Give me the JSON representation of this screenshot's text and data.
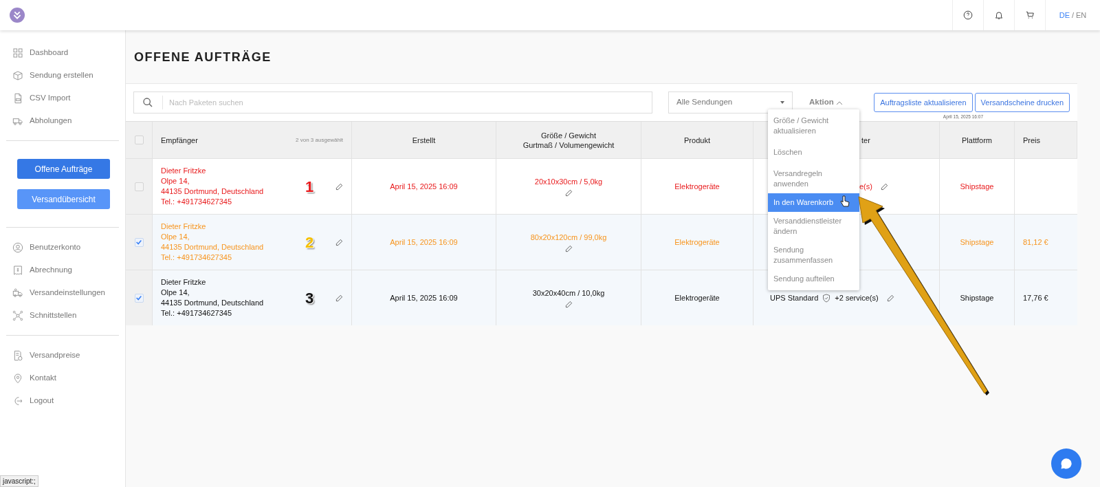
{
  "topbar": {
    "languages": [
      {
        "label": "DE",
        "selected": true
      },
      {
        "label": "EN",
        "selected": false
      }
    ],
    "language_separator": "/"
  },
  "sidebar": {
    "groups": [
      {
        "kind": "nav",
        "items": [
          "Dashboard",
          "Sendung erstellen",
          "CSV Import",
          "Abholungen"
        ]
      },
      {
        "kind": "buttons",
        "items": [
          {
            "label": "Offene Aufträge",
            "selected": true
          },
          {
            "label": "Versandübersicht",
            "selected": false
          }
        ]
      },
      {
        "kind": "nav",
        "items": [
          "Benutzerkonto",
          "Abrechnung",
          "Versandeinstellungen",
          "Schnittstellen"
        ]
      },
      {
        "kind": "nav",
        "items": [
          "Versandpreise",
          "Kontakt",
          "Logout"
        ]
      }
    ]
  },
  "page_title": "OFFENE AUFTRÄGE",
  "toolbar": {
    "search": {
      "placeholder": "Nach Paketen suchen"
    },
    "filter": {
      "value": "Alle Sendungen"
    },
    "action": {
      "label": "Aktion",
      "expanded": true
    },
    "buttons": [
      "Auftragsliste aktualisieren",
      "Versandscheine drucken"
    ],
    "last_updated": "April 15, 2025 16:07"
  },
  "action_menu": [
    {
      "label": "Größe / Gewicht aktualisieren",
      "selected": false
    },
    {
      "label": "Löschen",
      "selected": false
    },
    {
      "label": "Versandregeln anwenden",
      "selected": false
    },
    {
      "label": "In den Warenkorb",
      "selected": true
    },
    {
      "label": "Versanddienstleister ändern",
      "selected": false
    },
    {
      "label": "Sendung zusammenfassen",
      "selected": false
    },
    {
      "label": "Sendung aufteilen",
      "selected": false
    }
  ],
  "table": {
    "select_all": {
      "checked": false
    },
    "columns": [
      {
        "lines": [
          "Empfänger"
        ],
        "note": "2 von 3 ausgewählt"
      },
      {
        "lines": [
          "Erstellt"
        ]
      },
      {
        "lines": [
          "Größe / Gewicht",
          "Gurtmaß / Volumengewicht"
        ]
      },
      {
        "lines": [
          "Produkt"
        ]
      },
      {
        "lines": [
          "ter"
        ]
      },
      {
        "lines": [
          "Plattform"
        ]
      },
      {
        "lines": [
          "Preis"
        ]
      }
    ],
    "rows": [
      {
        "checked": false,
        "color": "#e8191b",
        "marker": {
          "label": "1",
          "color": "#e8191b"
        },
        "recipient": [
          "Dieter Fritzke",
          "Olpe 14,",
          "44135 Dortmund, Deutschland",
          "Tel.: +491734627345"
        ],
        "created": "April 15, 2025 16:09",
        "size": "20x10x30cm / 5,0kg",
        "product": "Elektrogeräte",
        "service": {
          "kind": "fragment",
          "text": "e(s)"
        },
        "platform": "Shipstage"
      },
      {
        "checked": true,
        "color": "#f7941d",
        "marker": {
          "label": "2",
          "color": "#f5c000"
        },
        "recipient": [
          "Dieter Fritzke",
          "Olpe 14,",
          "44135 Dortmund, Deutschland",
          "Tel.: +491734627345"
        ],
        "created": "April 15, 2025 16:09",
        "size": "80x20x120cm / 99,0kg",
        "product": "Elektrogeräte",
        "service": {
          "kind": "hidden"
        },
        "platform": "Shipstage",
        "price": "81,12 €"
      },
      {
        "checked": true,
        "color": "#111111",
        "marker": {
          "label": "3",
          "color": "#111111"
        },
        "recipient": [
          "Dieter Fritzke",
          "Olpe 14,",
          "44135 Dortmund, Deutschland",
          "Tel.: +491734627345"
        ],
        "created": "April 15, 2025 16:09",
        "size": "30x20x40cm / 10,0kg",
        "product": "Elektrogeräte",
        "service": {
          "kind": "full",
          "name": "UPS Standard",
          "extra": "+2 service(s)"
        },
        "platform": "Shipstage",
        "price": "17,76 €"
      }
    ]
  },
  "status_bar": "javascript:;"
}
